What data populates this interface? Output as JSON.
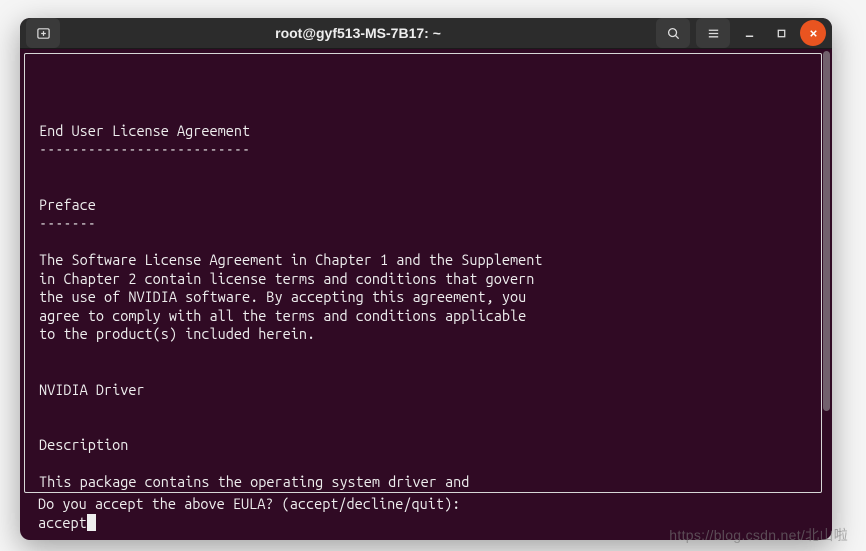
{
  "window": {
    "title": "root@gyf513-MS-7B17: ~"
  },
  "eula": {
    "heading": "End User License Agreement",
    "heading_underline": "--------------------------",
    "preface_label": "Preface",
    "preface_underline": "-------",
    "preface_body": "The Software License Agreement in Chapter 1 and the Supplement\nin Chapter 2 contain license terms and conditions that govern\nthe use of NVIDIA software. By accepting this agreement, you\nagree to comply with all the terms and conditions applicable\nto the product(s) included herein.",
    "driver_label": "NVIDIA Driver",
    "description_label": "Description",
    "description_body": "This package contains the operating system driver and"
  },
  "prompt": {
    "question": "Do you accept the above EULA? (accept/decline/quit):",
    "input": "accept"
  },
  "watermark": "https://blog.csdn.net/北山啦"
}
